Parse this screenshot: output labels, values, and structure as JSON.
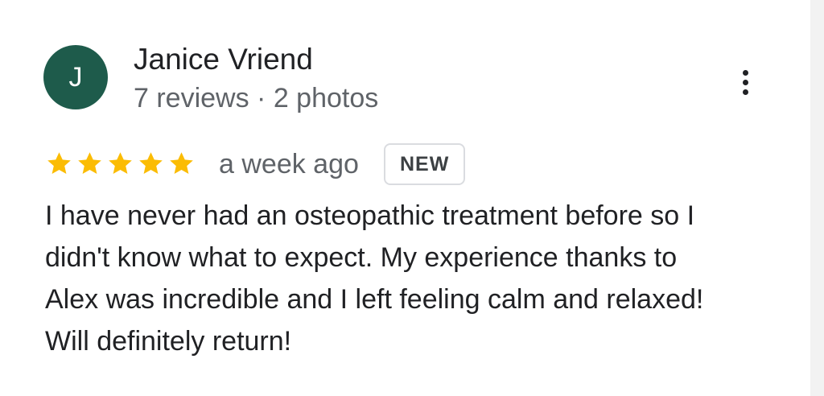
{
  "reviewer": {
    "initial": "J",
    "name": "Janice Vriend",
    "meta": "7 reviews · 2 photos",
    "avatar_color": "#1e5b4b"
  },
  "rating": {
    "stars": 5,
    "max": 5,
    "star_color": "#fbbc04"
  },
  "time_ago": "a week ago",
  "badge": "NEW",
  "more_menu_icon": "more-vert-icon",
  "review_lines": [
    "I have never had an osteopathic treatment before so I",
    "didn't know what to expect. My experience thanks to",
    "Alex was incredible and I left feeling calm and relaxed!",
    "Will definitely return!"
  ]
}
